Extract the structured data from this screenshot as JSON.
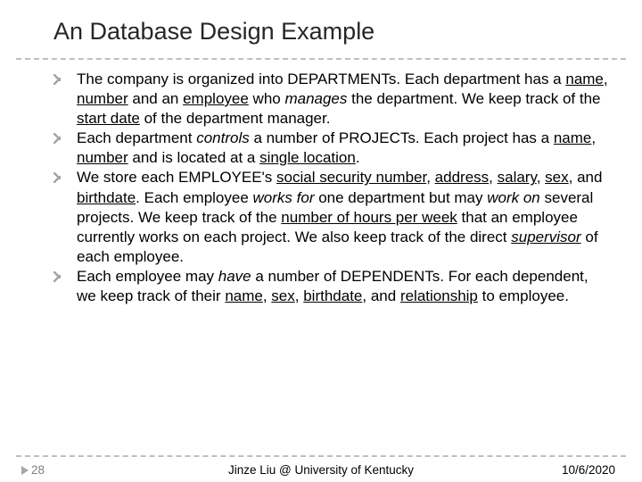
{
  "title": "An Database Design Example",
  "bullets": [
    {
      "segments": [
        {
          "t": "The company is organized into DEPARTMENTs. Each department has a "
        },
        {
          "t": "name",
          "u": true
        },
        {
          "t": ", "
        },
        {
          "t": "number",
          "u": true
        },
        {
          "t": " and an "
        },
        {
          "t": "employee",
          "u": true
        },
        {
          "t": " who "
        },
        {
          "t": "manages",
          "i": true
        },
        {
          "t": " the department. We keep track of the "
        },
        {
          "t": "start date",
          "u": true
        },
        {
          "t": " of the department manager."
        }
      ]
    },
    {
      "segments": [
        {
          "t": "Each department "
        },
        {
          "t": "controls",
          "i": true
        },
        {
          "t": " a number of PROJECTs. Each project has a "
        },
        {
          "t": "name",
          "u": true
        },
        {
          "t": ", "
        },
        {
          "t": "number",
          "u": true
        },
        {
          "t": " and is located at a "
        },
        {
          "t": "single location",
          "u": true
        },
        {
          "t": "."
        }
      ]
    },
    {
      "segments": [
        {
          "t": "We store each EMPLOYEE's "
        },
        {
          "t": "social security number",
          "u": true
        },
        {
          "t": ", "
        },
        {
          "t": "address",
          "u": true
        },
        {
          "t": ", "
        },
        {
          "t": "salary",
          "u": true
        },
        {
          "t": ", "
        },
        {
          "t": "sex",
          "u": true
        },
        {
          "t": ", and "
        },
        {
          "t": "birthdate",
          "u": true
        },
        {
          "t": ". Each employee "
        },
        {
          "t": "works for",
          "i": true
        },
        {
          "t": " one department but may "
        },
        {
          "t": "work on",
          "i": true
        },
        {
          "t": " several projects. We keep track of the "
        },
        {
          "t": "number of hours per week",
          "u": true
        },
        {
          "t": " that an employee currently works on each project. We also keep track of the direct "
        },
        {
          "t": "supervisor",
          "i": true,
          "u": true
        },
        {
          "t": " of each employee."
        }
      ]
    },
    {
      "segments": [
        {
          "t": "Each employee may "
        },
        {
          "t": "have",
          "i": true
        },
        {
          "t": " a number of DEPENDENTs. For each dependent, we keep track of their "
        },
        {
          "t": "name",
          "u": true
        },
        {
          "t": ", "
        },
        {
          "t": "sex",
          "u": true
        },
        {
          "t": ", "
        },
        {
          "t": "birthdate",
          "u": true
        },
        {
          "t": ", and "
        },
        {
          "t": "relationship",
          "u": true
        },
        {
          "t": " to employee."
        }
      ]
    }
  ],
  "footer": {
    "page": "28",
    "center": "Jinze Liu @ University of Kentucky",
    "date": "10/6/2020"
  }
}
